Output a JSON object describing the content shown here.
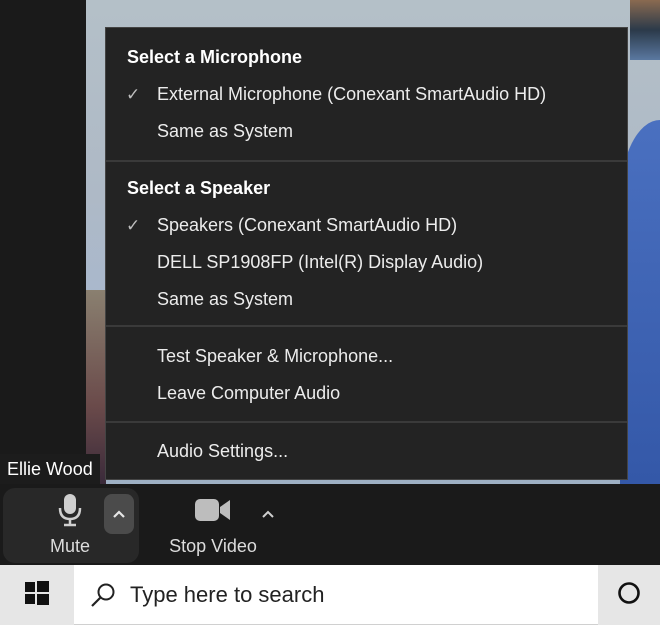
{
  "video": {
    "participant_name": "Ellie Wood"
  },
  "audio_menu": {
    "microphone_section": {
      "header": "Select a Microphone",
      "items": [
        {
          "label": "External Microphone (Conexant SmartAudio HD)",
          "selected": true
        },
        {
          "label": "Same as System",
          "selected": false
        }
      ]
    },
    "speaker_section": {
      "header": "Select a Speaker",
      "items": [
        {
          "label": "Speakers (Conexant SmartAudio HD)",
          "selected": true
        },
        {
          "label": "DELL SP1908FP (Intel(R) Display Audio)",
          "selected": false
        },
        {
          "label": "Same as System",
          "selected": false
        }
      ]
    },
    "actions": [
      {
        "label": "Test Speaker & Microphone..."
      },
      {
        "label": "Leave Computer Audio"
      }
    ],
    "settings": {
      "label": "Audio Settings..."
    },
    "check_glyph": "✓"
  },
  "toolbar": {
    "mute_label": "Mute",
    "stop_video_label": "Stop Video",
    "mute_icon": "microphone-icon",
    "video_icon": "video-camera-icon"
  },
  "taskbar": {
    "search_placeholder": "Type here to search",
    "start_icon": "windows-logo-icon",
    "cortana_icon": "cortana-circle-icon"
  },
  "colors": {
    "menu_background": "#232323",
    "toolbar_background": "#1a1a1a",
    "mute_group_background": "#282828",
    "caret_active_background": "#4b4b4b",
    "taskbar_background": "#e6e6e6"
  }
}
